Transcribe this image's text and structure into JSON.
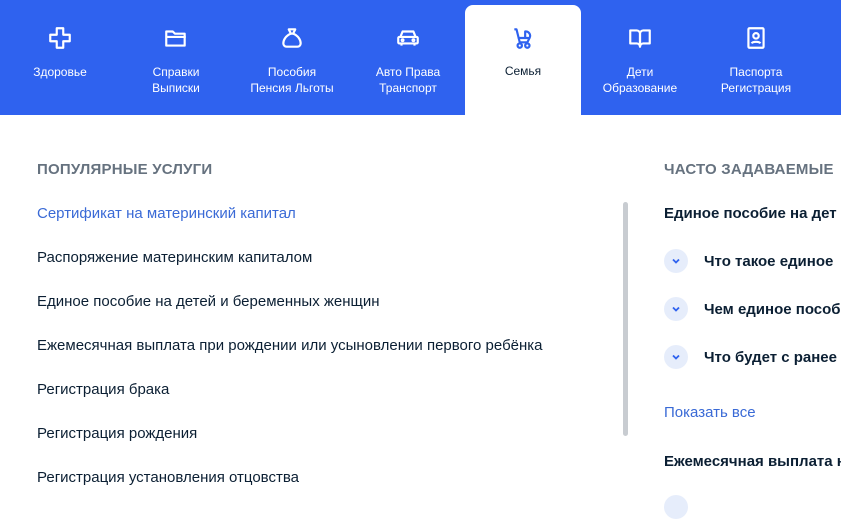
{
  "categories": [
    {
      "label": "Здоровье",
      "icon": "plus-cross-icon"
    },
    {
      "label": "Справки\nВыписки",
      "icon": "folder-icon"
    },
    {
      "label": "Пособия\nПенсия Льготы",
      "icon": "money-bag-icon"
    },
    {
      "label": "Авто Права\nТранспорт",
      "icon": "car-icon"
    },
    {
      "label": "Семья",
      "icon": "baby-stroller-icon",
      "active": true
    },
    {
      "label": "Дети\nОбразование",
      "icon": "open-book-icon"
    },
    {
      "label": "Паспорта\nРегистрация",
      "icon": "passport-icon"
    }
  ],
  "popular": {
    "title": "ПОПУЛЯРНЫЕ УСЛУГИ",
    "items": [
      "Сертификат на материнский капитал",
      "Распоряжение материнским капиталом",
      "Единое пособие на детей и беременных женщин",
      "Ежемесячная выплата при рождении или усыновлении первого ребёнка",
      "Регистрация брака",
      "Регистрация рождения",
      "Регистрация установления отцовства"
    ]
  },
  "faq": {
    "title": "ЧАСТО ЗАДАВАЕМЫЕ",
    "group1": "Единое пособие на дет",
    "questions": [
      "Что такое единое",
      "Чем единое пособ",
      "Что будет с ранее"
    ],
    "show_all": "Показать все",
    "group2": "Ежемесячная выплата н"
  },
  "colors": {
    "brand": "#2f62ef",
    "link": "#3a6ad6"
  }
}
